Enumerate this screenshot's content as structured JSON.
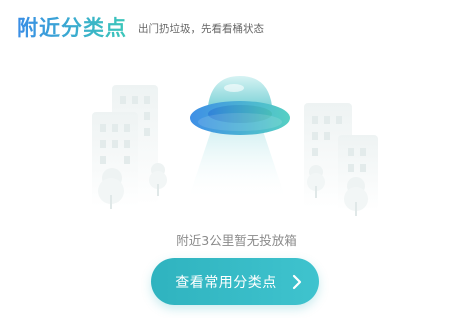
{
  "header": {
    "title": "附近分类点",
    "subtitle": "出门扔垃圾，先看看桶状态"
  },
  "empty_state": {
    "message": "附近3公里暂无投放箱",
    "illustration_icon": "ufo-city-illustration"
  },
  "cta": {
    "label": "查看常用分类点",
    "icon": "chevron-right-icon"
  },
  "colors": {
    "title_gradient_start": "#3a8ee6",
    "title_gradient_end": "#3bc7b9",
    "button": "#35bac6",
    "muted_text": "#8a8a8a"
  }
}
